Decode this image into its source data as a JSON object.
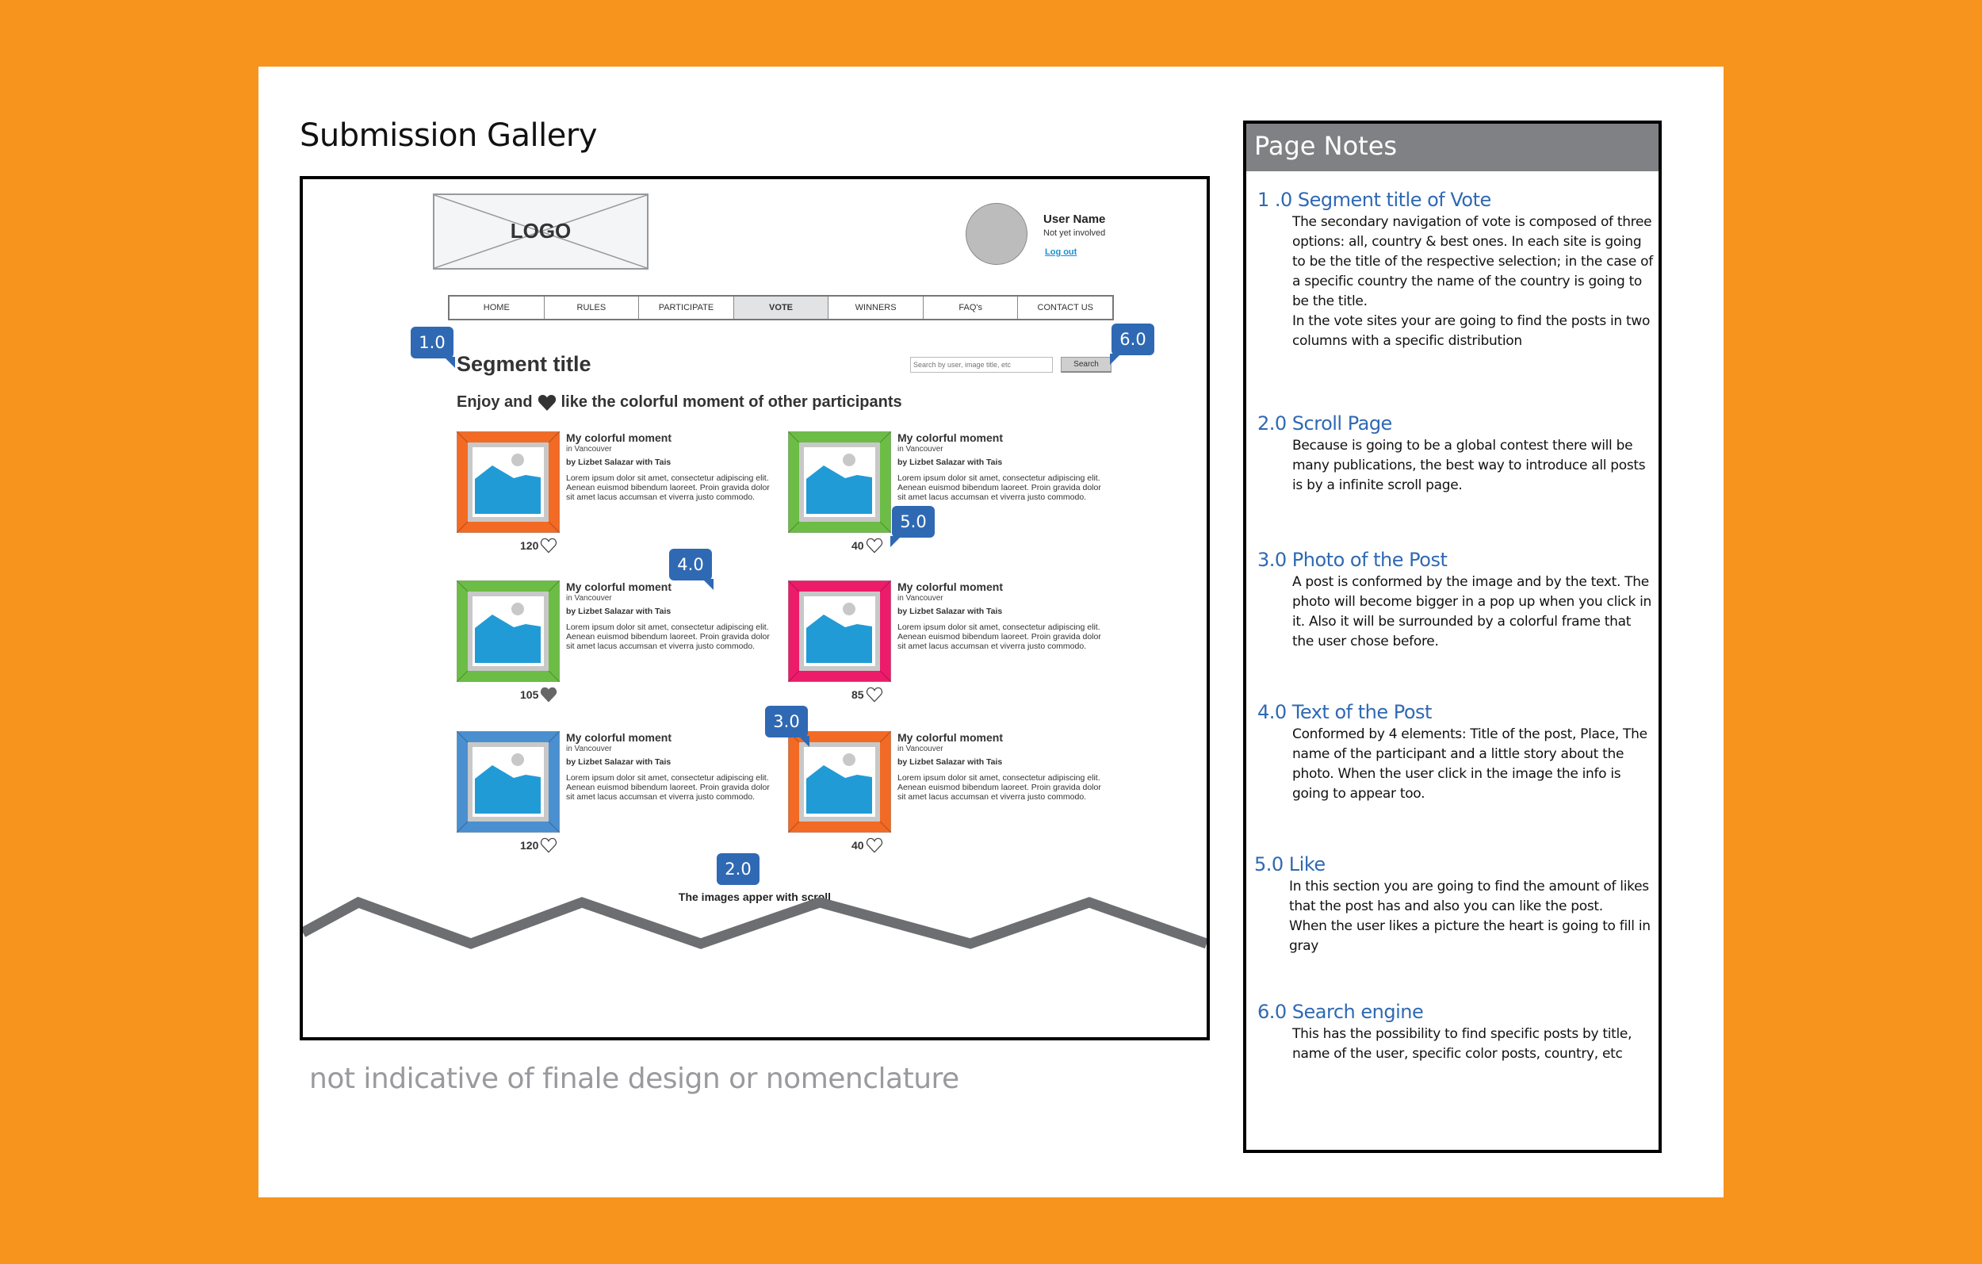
{
  "document": {
    "title": "Submission Gallery",
    "disclaimer": "not indicative of finale design or nomenclature"
  },
  "wireframe": {
    "logo_label": "LOGO",
    "user": {
      "name": "User Name",
      "status": "Not yet involved",
      "logout_label": "Log out"
    },
    "nav": [
      {
        "label": "HOME",
        "active": false
      },
      {
        "label": "RULES",
        "active": false
      },
      {
        "label": "PARTICIPATE",
        "active": false
      },
      {
        "label": "VOTE",
        "active": true
      },
      {
        "label": "WINNERS",
        "active": false
      },
      {
        "label": "FAQ's",
        "active": false
      },
      {
        "label": "CONTACT US",
        "active": false
      }
    ],
    "segment_title": "Segment title",
    "search": {
      "placeholder": "Search by user, image title, etc",
      "button_label": "Search"
    },
    "tagline": {
      "before": "Enjoy and",
      "after": "like the colorful moment of other participants",
      "icon": "heart-filled-icon"
    },
    "posts": [
      {
        "title": "My colorful moment",
        "place": "in Vancouver",
        "author": "by Lizbet Salazar with Tais",
        "story": "Lorem ipsum dolor sit amet, consectetur adipiscing elit. Aenean euismod bibendum laoreet. Proin gravida dolor sit amet lacus accumsan et viverra justo commodo.",
        "likes": "120",
        "liked": false,
        "frame_color": "#f26a24"
      },
      {
        "title": "My colorful moment",
        "place": "in Vancouver",
        "author": "by Lizbet Salazar with Tais",
        "story": "Lorem ipsum dolor sit amet, consectetur adipiscing elit. Aenean euismod bibendum laoreet. Proin gravida dolor sit amet lacus accumsan et viverra justo commodo.",
        "likes": "40",
        "liked": false,
        "frame_color": "#6cbd45"
      },
      {
        "title": "My colorful moment",
        "place": "in Vancouver",
        "author": "by Lizbet Salazar with Tais",
        "story": "Lorem ipsum dolor sit amet, consectetur adipiscing elit. Aenean euismod bibendum laoreet. Proin gravida dolor sit amet lacus accumsan et viverra justo commodo.",
        "likes": "105",
        "liked": true,
        "frame_color": "#6cbd45"
      },
      {
        "title": "My colorful moment",
        "place": "in Vancouver",
        "author": "by Lizbet Salazar with Tais",
        "story": "Lorem ipsum dolor sit amet, consectetur adipiscing elit. Aenean euismod bibendum laoreet. Proin gravida dolor sit amet lacus accumsan et viverra justo commodo.",
        "likes": "85",
        "liked": false,
        "frame_color": "#ec1c6a"
      },
      {
        "title": "My colorful moment",
        "place": "in Vancouver",
        "author": "by Lizbet Salazar with Tais",
        "story": "Lorem ipsum dolor sit amet, consectetur adipiscing elit. Aenean euismod bibendum laoreet. Proin gravida dolor sit amet lacus accumsan et viverra justo commodo.",
        "likes": "120",
        "liked": false,
        "frame_color": "#4a8fcf"
      },
      {
        "title": "My colorful moment",
        "place": "in Vancouver",
        "author": "by Lizbet Salazar with Tais",
        "story": "Lorem ipsum dolor sit amet, consectetur adipiscing elit. Aenean euismod bibendum laoreet. Proin gravida dolor sit amet lacus accumsan et viverra justo commodo.",
        "likes": "40",
        "liked": false,
        "frame_color": "#f26a24"
      }
    ],
    "scroll_note": "The images apper with scroll",
    "badges": {
      "segment": "1.0",
      "scroll": "2.0",
      "photo": "3.0",
      "text": "4.0",
      "like": "5.0",
      "search": "6.0"
    }
  },
  "notes": {
    "header": "Page Notes",
    "items": [
      {
        "heading": "1 .0 Segment title of Vote",
        "body": "The secondary navigation of vote is composed  of three options: all, country & best ones. In each site is going to be the title of the respective selection; in the case of a specific country the name of the country is going to be the title.\nIn the vote sites your are going to find the posts in two columns with a specific distribution"
      },
      {
        "heading": "2.0 Scroll Page",
        "body": "Because is going to be a global contest there will be many publications, the best way to introduce all posts is by a infinite scroll page."
      },
      {
        "heading": "3.0 Photo of the Post",
        "body": "A post is conformed by the image and by the text. The photo will become bigger in a pop up  when you click in it. Also it will be surrounded by a colorful frame that the user chose before."
      },
      {
        "heading": "4.0 Text of the Post",
        "body": "Conformed by 4 elements: Title of the post, Place, The name of the participant and a little story about the photo. When the user click in the image the info is going to appear too."
      },
      {
        "heading": "5.0 Like",
        "body": "In this section you are going to find the amount of likes that the post has and also you can like the post.\nWhen the user likes a picture the heart is going to fill in gray"
      },
      {
        "heading": "6.0 Search engine",
        "body": "This has the possibility to find specific posts by title, name of the user, specific color posts, country, etc"
      }
    ]
  },
  "colors": {
    "background": "#f7941d",
    "badge": "#2f69b3",
    "note_heading": "#2f69b3",
    "notes_header": "#808184",
    "photo_sky": "#219bd6",
    "liked_heart": "#666666"
  }
}
